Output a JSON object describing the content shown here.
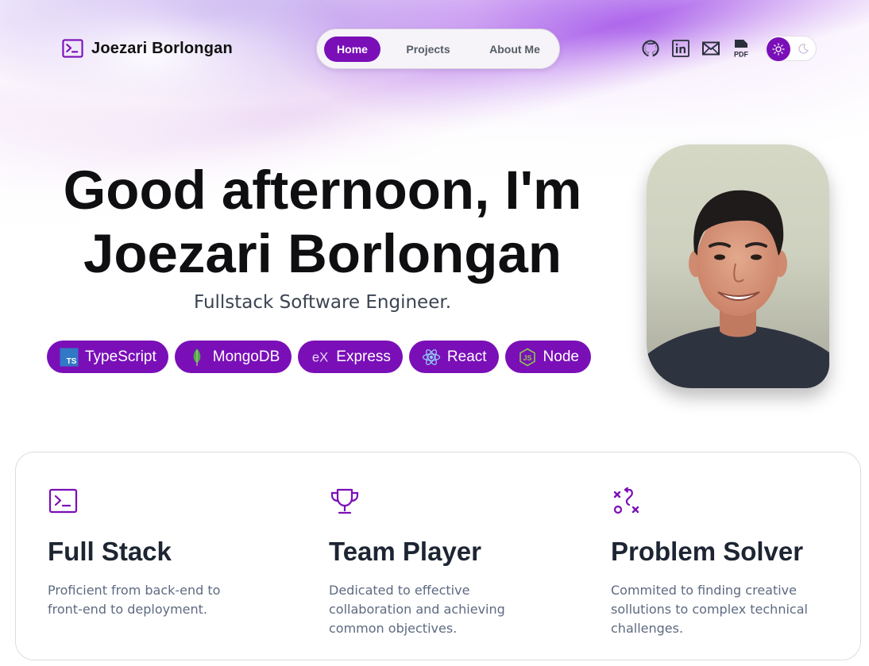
{
  "header": {
    "logo_name": "Joezari Borlongan",
    "nav": [
      {
        "label": "Home",
        "active": true
      },
      {
        "label": "Projects",
        "active": false
      },
      {
        "label": "About Me",
        "active": false
      }
    ],
    "social_icons": [
      "github-icon",
      "linkedin-icon",
      "mail-icon",
      "pdf-icon"
    ],
    "social_pdf_label": "PDF",
    "theme_toggle": {
      "selected": "light"
    }
  },
  "hero": {
    "title_line1": "Good afternoon, I'm",
    "title_line2": "Joezari Borlongan",
    "subtitle": "Fullstack Software Engineer.",
    "skills": [
      {
        "label": "TypeScript",
        "icon": "typescript-icon"
      },
      {
        "label": "MongoDB",
        "icon": "mongodb-icon"
      },
      {
        "label": "Express",
        "icon": "express-icon"
      },
      {
        "label": "React",
        "icon": "react-icon"
      },
      {
        "label": "Node",
        "icon": "nodejs-icon"
      }
    ],
    "typescript_badge": "TS",
    "express_badge": "eX",
    "node_badge": "JS"
  },
  "features": [
    {
      "icon": "terminal-icon",
      "title": "Full Stack",
      "desc": "Proficient from back-end to front-end to deployment."
    },
    {
      "icon": "trophy-icon",
      "title": "Team Player",
      "desc": "Dedicated to effective collaboration and achieving common objectives."
    },
    {
      "icon": "strategy-icon",
      "title": "Problem Solver",
      "desc": "Commited to finding creative sollutions to complex technical challenges."
    }
  ],
  "colors": {
    "accent": "#7a0fb8",
    "heading": "#1d2533",
    "body_text": "#5e6a80"
  }
}
